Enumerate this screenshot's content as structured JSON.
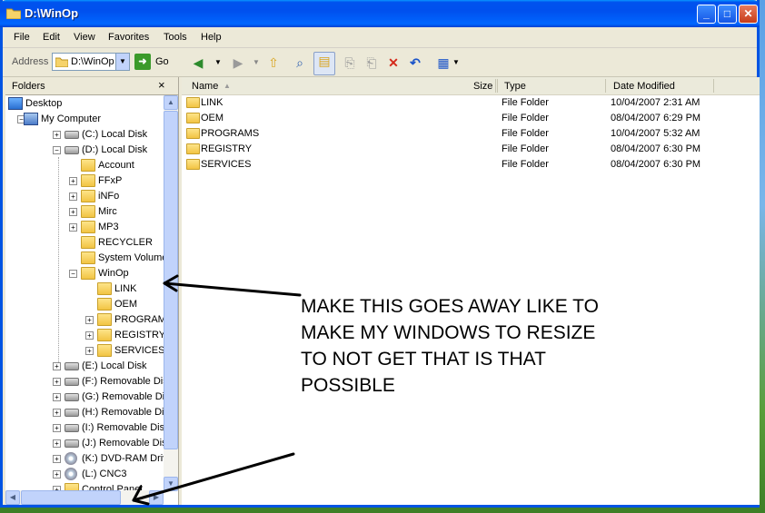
{
  "window": {
    "title": "D:\\WinOp",
    "min_glyph": "_",
    "max_glyph": "□",
    "close_glyph": "✕",
    "title_color": "#0054e3"
  },
  "menu": [
    "File",
    "Edit",
    "View",
    "Favorites",
    "Tools",
    "Help"
  ],
  "address": {
    "label": "Address",
    "value": "D:\\WinOp",
    "go_label": "Go"
  },
  "toolbar_icons": [
    "back-icon",
    "forward-icon",
    "up-folder-icon",
    "search-icon",
    "folders-icon",
    "move-to-icon",
    "copy-to-icon",
    "delete-icon",
    "undo-icon",
    "views-icon"
  ],
  "folders_pane": {
    "title": "Folders",
    "close_glyph": "×",
    "tree": [
      {
        "label": "Desktop",
        "level": 0,
        "exp": "",
        "icon": "desktop"
      },
      {
        "label": "My Computer",
        "level": 1,
        "exp": "-",
        "icon": "computer"
      },
      {
        "label": "(C:) Local Disk",
        "level": 2,
        "exp": "+",
        "icon": "drive"
      },
      {
        "label": "(D:) Local Disk",
        "level": 2,
        "exp": "-",
        "icon": "drive"
      },
      {
        "label": "Account",
        "level": 3,
        "exp": "",
        "icon": "folder"
      },
      {
        "label": "FFxP",
        "level": 3,
        "exp": "+",
        "icon": "folder"
      },
      {
        "label": "iNFo",
        "level": 3,
        "exp": "+",
        "icon": "folder"
      },
      {
        "label": "Mirc",
        "level": 3,
        "exp": "+",
        "icon": "folder"
      },
      {
        "label": "MP3",
        "level": 3,
        "exp": "+",
        "icon": "folder"
      },
      {
        "label": "RECYCLER",
        "level": 3,
        "exp": "",
        "icon": "folder"
      },
      {
        "label": "System Volume Inf",
        "level": 3,
        "exp": "",
        "icon": "folder"
      },
      {
        "label": "WinOp",
        "level": 3,
        "exp": "-",
        "icon": "folder-open"
      },
      {
        "label": "LINK",
        "level": 4,
        "exp": "",
        "icon": "folder"
      },
      {
        "label": "OEM",
        "level": 4,
        "exp": "",
        "icon": "folder"
      },
      {
        "label": "PROGRAMS",
        "level": 4,
        "exp": "+",
        "icon": "folder"
      },
      {
        "label": "REGISTRY",
        "level": 4,
        "exp": "+",
        "icon": "folder"
      },
      {
        "label": "SERVICES",
        "level": 4,
        "exp": "+",
        "icon": "folder"
      },
      {
        "label": "(E:) Local Disk",
        "level": 2,
        "exp": "+",
        "icon": "drive"
      },
      {
        "label": "(F:) Removable Disk",
        "level": 2,
        "exp": "+",
        "icon": "drive"
      },
      {
        "label": "(G:) Removable Disk",
        "level": 2,
        "exp": "+",
        "icon": "drive"
      },
      {
        "label": "(H:) Removable Disk",
        "level": 2,
        "exp": "+",
        "icon": "drive"
      },
      {
        "label": "(I:) Removable Disk",
        "level": 2,
        "exp": "+",
        "icon": "drive"
      },
      {
        "label": "(J:) Removable Disk",
        "level": 2,
        "exp": "+",
        "icon": "drive"
      },
      {
        "label": "(K:) DVD-RAM Drive",
        "level": 2,
        "exp": "+",
        "icon": "dvd"
      },
      {
        "label": "(L:) CNC3",
        "level": 2,
        "exp": "+",
        "icon": "dvd"
      },
      {
        "label": "Control Panel",
        "level": 2,
        "exp": "+",
        "icon": "folder"
      }
    ]
  },
  "files": {
    "columns": [
      "Name",
      "Size",
      "Type",
      "Date Modified"
    ],
    "rows": [
      {
        "name": "LINK",
        "size": "",
        "type": "File Folder",
        "date": "10/04/2007 2:31 AM"
      },
      {
        "name": "OEM",
        "size": "",
        "type": "File Folder",
        "date": "08/04/2007 6:29 PM"
      },
      {
        "name": "PROGRAMS",
        "size": "",
        "type": "File Folder",
        "date": "10/04/2007 5:32 AM"
      },
      {
        "name": "REGISTRY",
        "size": "",
        "type": "File Folder",
        "date": "08/04/2007 6:30 PM"
      },
      {
        "name": "SERVICES",
        "size": "",
        "type": "File Folder",
        "date": "08/04/2007 6:30 PM"
      }
    ]
  },
  "annotation": {
    "lines": [
      "MAKE THIS GOES AWAY LIKE TO",
      "MAKE MY WINDOWS TO RESIZE",
      "TO NOT GET THAT IS THAT",
      "POSSIBLE"
    ]
  }
}
